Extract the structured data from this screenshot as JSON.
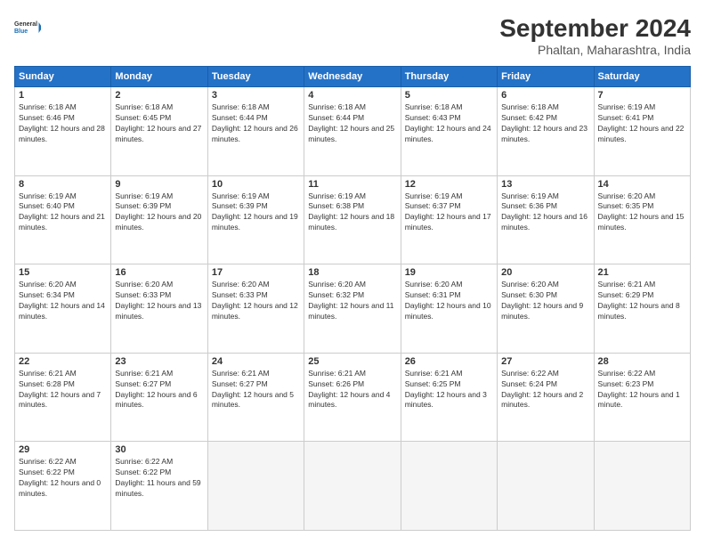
{
  "header": {
    "logo_general": "General",
    "logo_blue": "Blue",
    "month_title": "September 2024",
    "location": "Phaltan, Maharashtra, India"
  },
  "calendar": {
    "days_of_week": [
      "Sunday",
      "Monday",
      "Tuesday",
      "Wednesday",
      "Thursday",
      "Friday",
      "Saturday"
    ],
    "weeks": [
      [
        {
          "day": "",
          "empty": true
        },
        {
          "day": "2",
          "sunrise": "6:18 AM",
          "sunset": "6:45 PM",
          "daylight": "12 hours and 27 minutes."
        },
        {
          "day": "3",
          "sunrise": "6:18 AM",
          "sunset": "6:44 PM",
          "daylight": "12 hours and 26 minutes."
        },
        {
          "day": "4",
          "sunrise": "6:18 AM",
          "sunset": "6:44 PM",
          "daylight": "12 hours and 25 minutes."
        },
        {
          "day": "5",
          "sunrise": "6:18 AM",
          "sunset": "6:43 PM",
          "daylight": "12 hours and 24 minutes."
        },
        {
          "day": "6",
          "sunrise": "6:18 AM",
          "sunset": "6:42 PM",
          "daylight": "12 hours and 23 minutes."
        },
        {
          "day": "7",
          "sunrise": "6:19 AM",
          "sunset": "6:41 PM",
          "daylight": "12 hours and 22 minutes."
        }
      ],
      [
        {
          "day": "1",
          "sunrise": "6:18 AM",
          "sunset": "6:46 PM",
          "daylight": "12 hours and 28 minutes."
        },
        {
          "day": "8",
          "sunrise": "6:19 AM",
          "sunset": "6:40 PM",
          "daylight": "12 hours and 21 minutes."
        },
        {
          "day": "9",
          "sunrise": "6:19 AM",
          "sunset": "6:39 PM",
          "daylight": "12 hours and 20 minutes."
        },
        {
          "day": "10",
          "sunrise": "6:19 AM",
          "sunset": "6:39 PM",
          "daylight": "12 hours and 19 minutes."
        },
        {
          "day": "11",
          "sunrise": "6:19 AM",
          "sunset": "6:38 PM",
          "daylight": "12 hours and 18 minutes."
        },
        {
          "day": "12",
          "sunrise": "6:19 AM",
          "sunset": "6:37 PM",
          "daylight": "12 hours and 17 minutes."
        },
        {
          "day": "13",
          "sunrise": "6:19 AM",
          "sunset": "6:36 PM",
          "daylight": "12 hours and 16 minutes."
        },
        {
          "day": "14",
          "sunrise": "6:20 AM",
          "sunset": "6:35 PM",
          "daylight": "12 hours and 15 minutes."
        }
      ],
      [
        {
          "day": "15",
          "sunrise": "6:20 AM",
          "sunset": "6:34 PM",
          "daylight": "12 hours and 14 minutes."
        },
        {
          "day": "16",
          "sunrise": "6:20 AM",
          "sunset": "6:33 PM",
          "daylight": "12 hours and 13 minutes."
        },
        {
          "day": "17",
          "sunrise": "6:20 AM",
          "sunset": "6:33 PM",
          "daylight": "12 hours and 12 minutes."
        },
        {
          "day": "18",
          "sunrise": "6:20 AM",
          "sunset": "6:32 PM",
          "daylight": "12 hours and 11 minutes."
        },
        {
          "day": "19",
          "sunrise": "6:20 AM",
          "sunset": "6:31 PM",
          "daylight": "12 hours and 10 minutes."
        },
        {
          "day": "20",
          "sunrise": "6:20 AM",
          "sunset": "6:30 PM",
          "daylight": "12 hours and 9 minutes."
        },
        {
          "day": "21",
          "sunrise": "6:21 AM",
          "sunset": "6:29 PM",
          "daylight": "12 hours and 8 minutes."
        }
      ],
      [
        {
          "day": "22",
          "sunrise": "6:21 AM",
          "sunset": "6:28 PM",
          "daylight": "12 hours and 7 minutes."
        },
        {
          "day": "23",
          "sunrise": "6:21 AM",
          "sunset": "6:27 PM",
          "daylight": "12 hours and 6 minutes."
        },
        {
          "day": "24",
          "sunrise": "6:21 AM",
          "sunset": "6:27 PM",
          "daylight": "12 hours and 5 minutes."
        },
        {
          "day": "25",
          "sunrise": "6:21 AM",
          "sunset": "6:26 PM",
          "daylight": "12 hours and 4 minutes."
        },
        {
          "day": "26",
          "sunrise": "6:21 AM",
          "sunset": "6:25 PM",
          "daylight": "12 hours and 3 minutes."
        },
        {
          "day": "27",
          "sunrise": "6:22 AM",
          "sunset": "6:24 PM",
          "daylight": "12 hours and 2 minutes."
        },
        {
          "day": "28",
          "sunrise": "6:22 AM",
          "sunset": "6:23 PM",
          "daylight": "12 hours and 1 minute."
        }
      ],
      [
        {
          "day": "29",
          "sunrise": "6:22 AM",
          "sunset": "6:22 PM",
          "daylight": "12 hours and 0 minutes."
        },
        {
          "day": "30",
          "sunrise": "6:22 AM",
          "sunset": "6:22 PM",
          "daylight": "11 hours and 59 minutes."
        },
        {
          "day": "",
          "empty": true
        },
        {
          "day": "",
          "empty": true
        },
        {
          "day": "",
          "empty": true
        },
        {
          "day": "",
          "empty": true
        },
        {
          "day": "",
          "empty": true
        }
      ]
    ]
  }
}
